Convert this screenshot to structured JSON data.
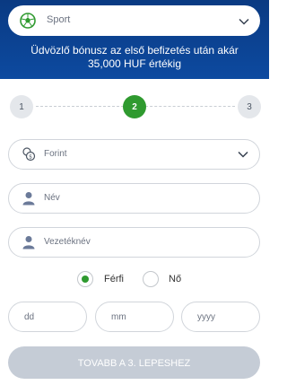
{
  "header": {
    "sport_select": {
      "label": "Sport",
      "icon": "soccer-ball-icon"
    },
    "bonus_line1": "Üdvözlő bónusz az első befizetés után akár",
    "bonus_line2": "35,000 HUF értékig"
  },
  "steps": {
    "items": [
      "1",
      "2",
      "3"
    ],
    "current": "2"
  },
  "form": {
    "currency": {
      "value": "Forint",
      "icon": "coins-icon"
    },
    "first_name": {
      "placeholder": "Név",
      "icon": "user-icon"
    },
    "last_name": {
      "placeholder": "Vezetéknév",
      "icon": "user-icon"
    },
    "gender": {
      "male": "Férfi",
      "female": "Nő",
      "selected": "Férfi"
    },
    "dob": {
      "day": "dd",
      "month": "mm",
      "year": "yyyy"
    },
    "next_button": "TOVABB A 3. LEPESHEZ"
  },
  "colors": {
    "header_bg": "#0d4aa0",
    "accent": "#2f9a2f",
    "button_disabled": "#c5ccd6"
  }
}
